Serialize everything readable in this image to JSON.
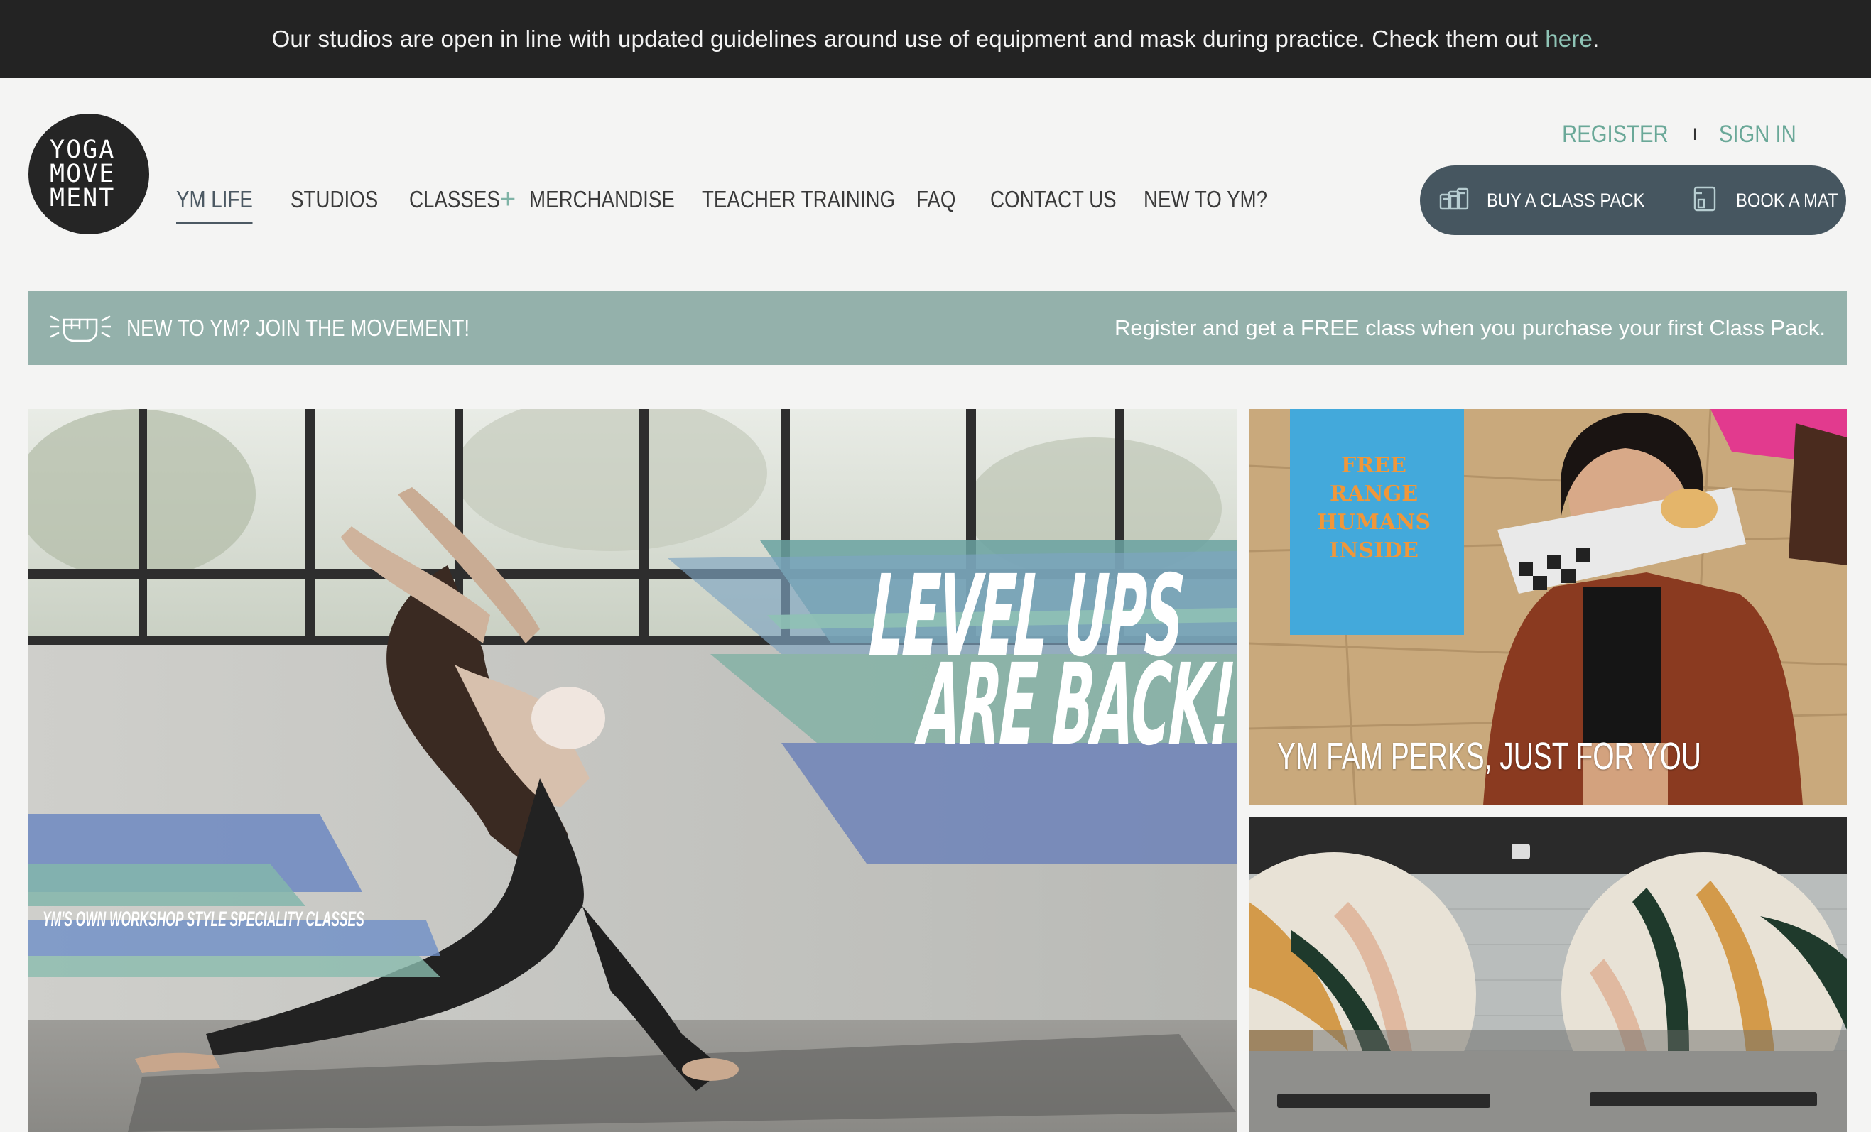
{
  "announcement": {
    "text": "Our studios are open in line with updated guidelines around use of equipment and mask during practice. Check them out",
    "link_text": "here",
    "trailing": "."
  },
  "logo": {
    "line1": "YOGA",
    "line2": "MOVE",
    "line3": "MENT"
  },
  "nav": {
    "items": [
      {
        "label": "YM Life",
        "active": true
      },
      {
        "label": "Studios"
      },
      {
        "label": "Classes",
        "has_submenu": true,
        "submenu_icon": "plus-icon"
      },
      {
        "label": "Merchandise"
      },
      {
        "label": "Teacher Training"
      },
      {
        "label": "FAQ"
      },
      {
        "label": "Contact Us"
      },
      {
        "label": "New to YM?"
      }
    ]
  },
  "auth": {
    "register": "Register",
    "separator": "I",
    "sign_in": "Sign In"
  },
  "cta": {
    "buy_class_pack": {
      "label": "Buy a Class Pack",
      "icon": "class-pack-icon"
    },
    "book_mat": {
      "label": "Book a Mat",
      "icon": "mat-icon"
    }
  },
  "promo": {
    "icon": "fist-icon",
    "title": "New to YM? Join the Movement!",
    "text": "Register and get a FREE class when you purchase your first Class Pack."
  },
  "hero": {
    "title_line1": "Level Ups",
    "title_line2": "Are Back!",
    "subtitle": "YM's own workshop style speciality classes"
  },
  "tiles": [
    {
      "caption": "YM Fam Perks, Just For You",
      "poster_text": "FREE RANGE HUMANS INSIDE"
    },
    {
      "caption": ""
    }
  ],
  "colors": {
    "announcement_bg": "#232323",
    "accent_teal": "#6aa898",
    "nav_active": "#4c5963",
    "cta_bg": "#465660",
    "promo_bg": "#94b1ab",
    "page_bg": "#f4f4f3"
  }
}
